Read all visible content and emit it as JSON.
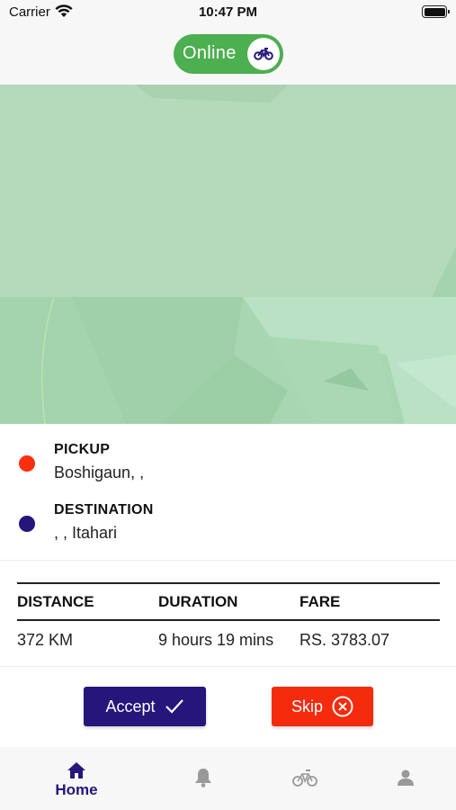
{
  "status_bar": {
    "carrier": "Carrier",
    "time": "10:47 PM"
  },
  "header": {
    "online_label": "Online",
    "toggle_icon": "bike-icon"
  },
  "map": {
    "type": "map-view"
  },
  "trip": {
    "pickup": {
      "title": "PICKUP",
      "value": "Boshigaun, ,",
      "color": "#ff2e0f"
    },
    "destination": {
      "title": "DESTINATION",
      "value": ", , Itahari",
      "color": "#26157a"
    }
  },
  "info": {
    "headers": [
      "DISTANCE",
      "DURATION",
      "FARE"
    ],
    "values": [
      "372 KM",
      "9 hours 19 mins",
      "RS. 3783.07"
    ]
  },
  "actions": {
    "accept_label": "Accept",
    "skip_label": "Skip",
    "accept_color": "#26157a",
    "skip_color": "#f42b0c"
  },
  "tabbar": {
    "items": [
      {
        "label": "Home",
        "icon": "home-icon",
        "active": true
      },
      {
        "label": "",
        "icon": "bell-icon",
        "active": false
      },
      {
        "label": "",
        "icon": "bike-icon",
        "active": false
      },
      {
        "label": "",
        "icon": "person-icon",
        "active": false
      }
    ],
    "active_color": "#26157a",
    "inactive_color": "#999999"
  },
  "colors": {
    "online_green": "#4caf50",
    "map_green": "#b4d9bb"
  }
}
